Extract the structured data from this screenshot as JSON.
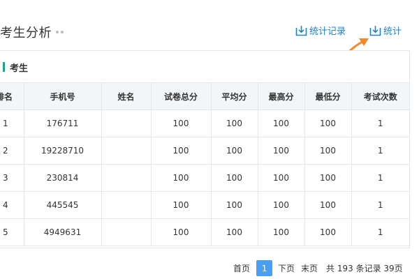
{
  "header": {
    "title": "考生分析",
    "records_label": "统计记录",
    "stats_label": "统计"
  },
  "panel": {
    "title": "考生"
  },
  "table": {
    "columns": [
      "排名",
      "手机号",
      "姓名",
      "试卷总分",
      "平均分",
      "最高分",
      "最低分",
      "考试次数"
    ],
    "rows": [
      [
        "1",
        "176711",
        "",
        "100",
        "100",
        "100",
        "100",
        "1"
      ],
      [
        "2",
        "19228710",
        "",
        "100",
        "100",
        "100",
        "100",
        "1"
      ],
      [
        "3",
        "230814",
        "",
        "100",
        "100",
        "100",
        "100",
        "1"
      ],
      [
        "4",
        "445545",
        "",
        "100",
        "100",
        "100",
        "100",
        "1"
      ],
      [
        "5",
        "4949631",
        "",
        "100",
        "100",
        "100",
        "100",
        "1"
      ]
    ]
  },
  "pagination": {
    "first": "首页",
    "current": "1",
    "next": "下页",
    "last": "末页",
    "summary": "共 193 条记录 39页"
  },
  "colors": {
    "link": "#1e80c8",
    "accent_bar": "#1aa28a",
    "arrow": "#f08a2c",
    "current_page": "#4a9ff5"
  },
  "icons": {
    "records": "download-icon",
    "stats": "download-icon",
    "pointer": "arrow-icon"
  }
}
